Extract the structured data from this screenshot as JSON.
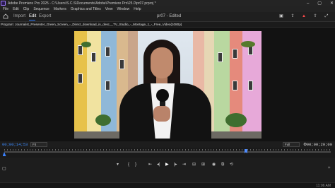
{
  "window": {
    "title": "Adobe Premiere Pro 2025 - C:\\Users\\S.C.S\\Documents\\Adobe\\Premiere Pro\\25.0\\pr07.prproj *",
    "controls": [
      "–",
      "▢",
      "✕"
    ]
  },
  "menu": [
    "File",
    "Edit",
    "Clip",
    "Sequence",
    "Markers",
    "Graphics and Titles",
    "View",
    "Window",
    "Help"
  ],
  "workspace": {
    "tabs": [
      "Import",
      "Edit",
      "Export"
    ],
    "active_tab": "Edit",
    "doc_title": "pr07 - Edited",
    "icons": [
      "workspaces-icon",
      "share-icon",
      "alert-icon",
      "quick-export-icon",
      "fullscreen-icon"
    ],
    "alert_color": "#ff4a4a",
    "accent": "#2f7bff"
  },
  "program_panel": {
    "tab_label": "Program: Journalist_Presenter_Green_Screen_-_Direct_download_in_desc__TV_Studio_-_Montage_1_-_Free_Video(1080p)"
  },
  "viewer": {
    "timecode_current": "00;00;14;53",
    "zoom_option": "Fit",
    "resolution_option": "Full",
    "timecode_duration": "00;00;20;00",
    "in_point_fraction": 0.74,
    "playhead_fraction": 0.0
  },
  "transport": {
    "left_icons": [
      "add-marker-icon",
      "set-in-icon",
      "set-out-icon"
    ],
    "center_icons": [
      "go-to-in-icon",
      "step-back-icon",
      "play-icon",
      "step-forward-icon",
      "go-to-out-icon",
      "insert-icon",
      "overwrite-icon",
      "export-frame-icon",
      "comparison-view-icon",
      "vr-icon"
    ],
    "right_icon": "button-editor-icon"
  },
  "taskbar": {
    "clock": "11:06 AM"
  }
}
